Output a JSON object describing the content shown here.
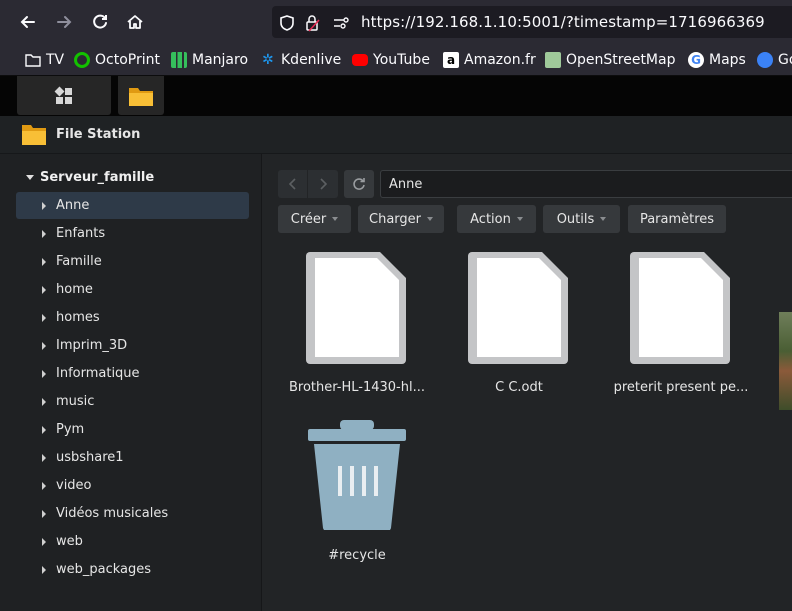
{
  "browser": {
    "url": "https://192.168.1.10:5001/?timestamp=1716966369"
  },
  "bookmarks": [
    {
      "label": "TV",
      "icon": "folder-icon"
    },
    {
      "label": "OctoPrint",
      "icon": "octoprint-icon"
    },
    {
      "label": "Manjaro",
      "icon": "manjaro-icon"
    },
    {
      "label": "Kdenlive",
      "icon": "kdenlive-icon"
    },
    {
      "label": "YouTube",
      "icon": "youtube-icon"
    },
    {
      "label": "Amazon.fr",
      "icon": "amazon-icon"
    },
    {
      "label": "OpenStreetMap",
      "icon": "openstreetmap-icon"
    },
    {
      "label": "Maps",
      "icon": "google-icon"
    },
    {
      "label": "Go",
      "icon": "globe-icon"
    }
  ],
  "window": {
    "title": "File Station"
  },
  "sidebar": {
    "root": "Serveur_famille",
    "items": [
      "Anne",
      "Enfants",
      "Famille",
      "home",
      "homes",
      "Imprim_3D",
      "Informatique",
      "music",
      "Pym",
      "usbshare1",
      "video",
      "Vidéos musicales",
      "web",
      "web_packages"
    ],
    "selected": "Anne"
  },
  "toolbar": {
    "path": "Anne",
    "buttons": {
      "create": "Créer",
      "upload": "Charger",
      "action": "Action",
      "tools": "Outils",
      "settings": "Paramètres"
    }
  },
  "files": [
    {
      "name": "Brother-HL-1430-hl...",
      "type": "document"
    },
    {
      "name": "C C.odt",
      "type": "document"
    },
    {
      "name": "preterit present pe...",
      "type": "document"
    },
    {
      "name": "#recycle",
      "type": "recycle-bin"
    }
  ],
  "colors": {
    "selected_bg": "#2e3a48",
    "folder": "#f5b82e",
    "recycle_bin": "#8fb0c2"
  }
}
